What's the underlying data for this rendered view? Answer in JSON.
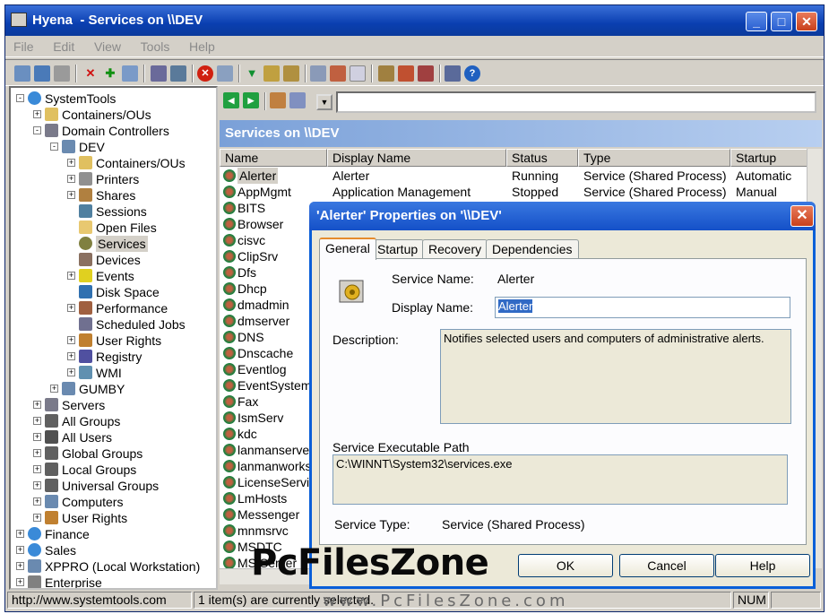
{
  "window": {
    "title": "Hyena  - Services on \\\\DEV"
  },
  "menu": [
    "File",
    "Edit",
    "View",
    "Tools",
    "Help"
  ],
  "tree": [
    {
      "label": "SystemTools",
      "icon": "globe-icon",
      "level": 0,
      "exp": "-"
    },
    {
      "label": "Containers/OUs",
      "icon": "folder-icon",
      "level": 1,
      "exp": "+"
    },
    {
      "label": "Domain Controllers",
      "icon": "server-icon",
      "level": 1,
      "exp": "-"
    },
    {
      "label": "DEV",
      "icon": "computer-icon",
      "level": 2,
      "exp": "-"
    },
    {
      "label": "Containers/OUs",
      "icon": "folder-icon",
      "level": 3,
      "exp": "+"
    },
    {
      "label": "Printers",
      "icon": "printer-icon",
      "level": 3,
      "exp": "+"
    },
    {
      "label": "Shares",
      "icon": "share-icon",
      "level": 3,
      "exp": "+"
    },
    {
      "label": "Sessions",
      "icon": "sessions-icon",
      "level": 3,
      "exp": ""
    },
    {
      "label": "Open Files",
      "icon": "open-folder-icon",
      "level": 3,
      "exp": ""
    },
    {
      "label": "Services",
      "icon": "services-icon",
      "level": 3,
      "exp": "",
      "selected": true
    },
    {
      "label": "Devices",
      "icon": "devices-icon",
      "level": 3,
      "exp": ""
    },
    {
      "label": "Events",
      "icon": "warning-icon",
      "level": 3,
      "exp": "+"
    },
    {
      "label": "Disk Space",
      "icon": "disk-icon",
      "level": 3,
      "exp": ""
    },
    {
      "label": "Performance",
      "icon": "performance-icon",
      "level": 3,
      "exp": "+"
    },
    {
      "label": "Scheduled Jobs",
      "icon": "scheduled-icon",
      "level": 3,
      "exp": ""
    },
    {
      "label": "User Rights",
      "icon": "user-rights-icon",
      "level": 3,
      "exp": "+"
    },
    {
      "label": "Registry",
      "icon": "registry-icon",
      "level": 3,
      "exp": "+"
    },
    {
      "label": "WMI",
      "icon": "wmi-icon",
      "level": 3,
      "exp": "+"
    },
    {
      "label": "GUMBY",
      "icon": "computer-icon",
      "level": 2,
      "exp": "+"
    },
    {
      "label": "Servers",
      "icon": "server-icon",
      "level": 1,
      "exp": "+"
    },
    {
      "label": "All Groups",
      "icon": "group-icon",
      "level": 1,
      "exp": "+"
    },
    {
      "label": "All Users",
      "icon": "user-icon",
      "level": 1,
      "exp": "+"
    },
    {
      "label": "Global Groups",
      "icon": "group-icon",
      "level": 1,
      "exp": "+"
    },
    {
      "label": "Local Groups",
      "icon": "group-icon",
      "level": 1,
      "exp": "+"
    },
    {
      "label": "Universal Groups",
      "icon": "group-icon",
      "level": 1,
      "exp": "+"
    },
    {
      "label": "Computers",
      "icon": "computer-icon",
      "level": 1,
      "exp": "+"
    },
    {
      "label": "User Rights",
      "icon": "user-rights-icon",
      "level": 1,
      "exp": "+"
    },
    {
      "label": "Finance",
      "icon": "globe-icon",
      "level": 0,
      "exp": "+"
    },
    {
      "label": "Sales",
      "icon": "globe-icon",
      "level": 0,
      "exp": "+"
    },
    {
      "label": "XPPRO (Local Workstation)",
      "icon": "computer-icon",
      "level": 0,
      "exp": "+"
    },
    {
      "label": "Enterprise",
      "icon": "enterprise-icon",
      "level": 0,
      "exp": "+"
    }
  ],
  "panel": {
    "title": "Services on \\\\DEV",
    "columns": [
      "Name",
      "Display Name",
      "Status",
      "Type",
      "Startup"
    ],
    "rows": [
      {
        "name": "Alerter",
        "display": "Alerter",
        "status": "Running",
        "type": "Service (Shared Process)",
        "startup": "Automatic"
      },
      {
        "name": "AppMgmt",
        "display": "Application Management",
        "status": "Stopped",
        "type": "Service (Shared Process)",
        "startup": "Manual"
      },
      {
        "name": "BITS"
      },
      {
        "name": "Browser"
      },
      {
        "name": "cisvc"
      },
      {
        "name": "ClipSrv"
      },
      {
        "name": "Dfs"
      },
      {
        "name": "Dhcp"
      },
      {
        "name": "dmadmin"
      },
      {
        "name": "dmserver"
      },
      {
        "name": "DNS"
      },
      {
        "name": "Dnscache"
      },
      {
        "name": "Eventlog"
      },
      {
        "name": "EventSystem"
      },
      {
        "name": "Fax"
      },
      {
        "name": "IsmServ"
      },
      {
        "name": "kdc"
      },
      {
        "name": "lanmanserver"
      },
      {
        "name": "lanmanworkstation"
      },
      {
        "name": "LicenseService"
      },
      {
        "name": "LmHosts"
      },
      {
        "name": "Messenger"
      },
      {
        "name": "mnmsrvc"
      },
      {
        "name": "MSDTC"
      },
      {
        "name": "MSIServer"
      }
    ]
  },
  "dialog": {
    "title": "'Alerter' Properties on '\\\\DEV'",
    "tabs": [
      "General",
      "Startup",
      "Recovery",
      "Dependencies"
    ],
    "service_name_label": "Service Name:",
    "service_name": "Alerter",
    "display_name_label": "Display Name:",
    "display_name": "Alerter",
    "description_label": "Description:",
    "description": "Notifies selected users and computers of administrative alerts.",
    "exe_path_label": "Service Executable Path",
    "exe_path": "C:\\WINNT\\System32\\services.exe",
    "service_type_label": "Service Type:",
    "service_type": "Service (Shared Process)",
    "ok": "OK",
    "cancel": "Cancel",
    "help": "Help"
  },
  "status": {
    "url": "http://www.systemtools.com",
    "selected": "1 item(s) are currently selected.",
    "num": "NUM"
  },
  "watermark": {
    "brand": "PcFilesZone",
    "url": "www.PcFilesZone.com"
  }
}
